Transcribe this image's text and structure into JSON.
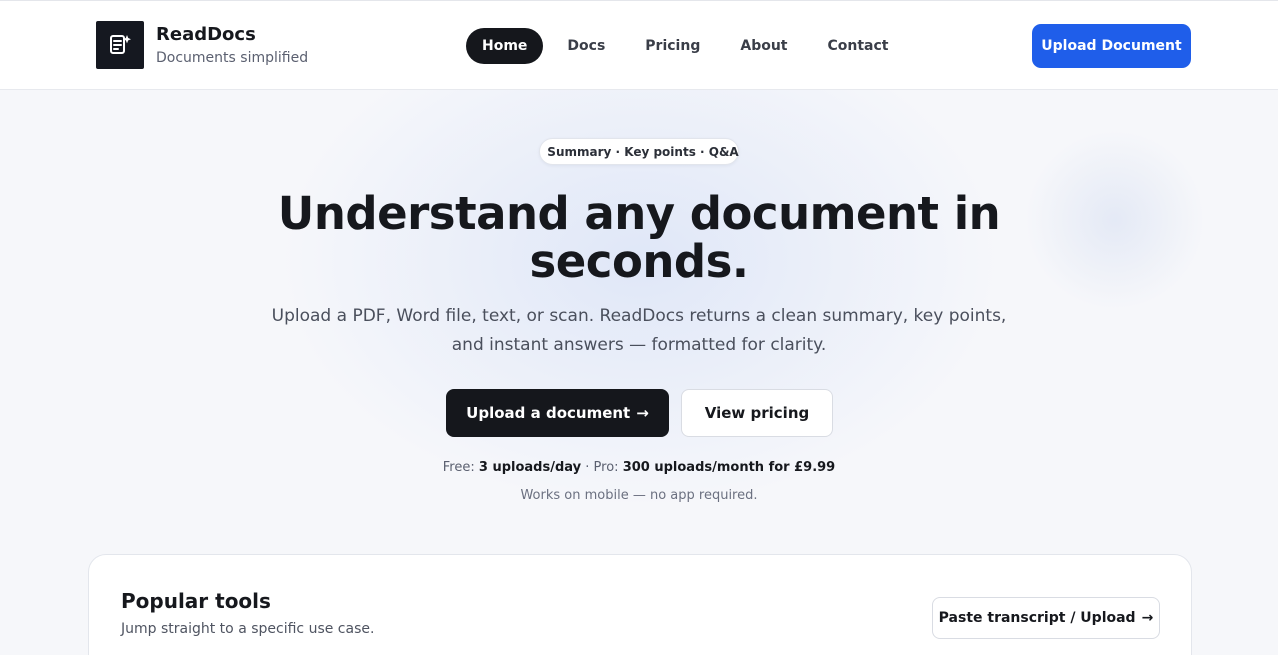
{
  "brand": {
    "name": "ReadDocs",
    "tagline": "Documents simplified",
    "logo_icon": "document-sparkle-icon"
  },
  "nav": {
    "items": [
      {
        "label": "Home",
        "active": true
      },
      {
        "label": "Docs",
        "active": false
      },
      {
        "label": "Pricing",
        "active": false
      },
      {
        "label": "About",
        "active": false
      },
      {
        "label": "Contact",
        "active": false
      }
    ],
    "upload_label": "Upload Document"
  },
  "hero": {
    "pill_text": "Summary · Key points · Q&A",
    "title": "Understand any document in seconds.",
    "subtitle": "Upload a PDF, Word file, text, or scan. ReadDocs returns a clean summary, key points, and instant answers — formatted for clarity.",
    "primary_cta": "Upload a document",
    "primary_cta_arrow": "→",
    "secondary_cta": "View pricing",
    "plans": {
      "free_prefix": "Free:",
      "free_value": "3 uploads/day",
      "separator": " · ",
      "pro_prefix": "Pro:",
      "pro_value": "300 uploads/month for £9.99"
    },
    "mobile_note": "Works on mobile — no app required."
  },
  "tools": {
    "title": "Popular tools",
    "subtitle": "Jump straight to a specific use case.",
    "button_label": "Paste transcript / Upload",
    "button_arrow": "→"
  },
  "colors": {
    "accent": "#1f5eea",
    "dark": "#15171c",
    "pill_dot": "#2460ea",
    "background": "#f6f7fa"
  }
}
